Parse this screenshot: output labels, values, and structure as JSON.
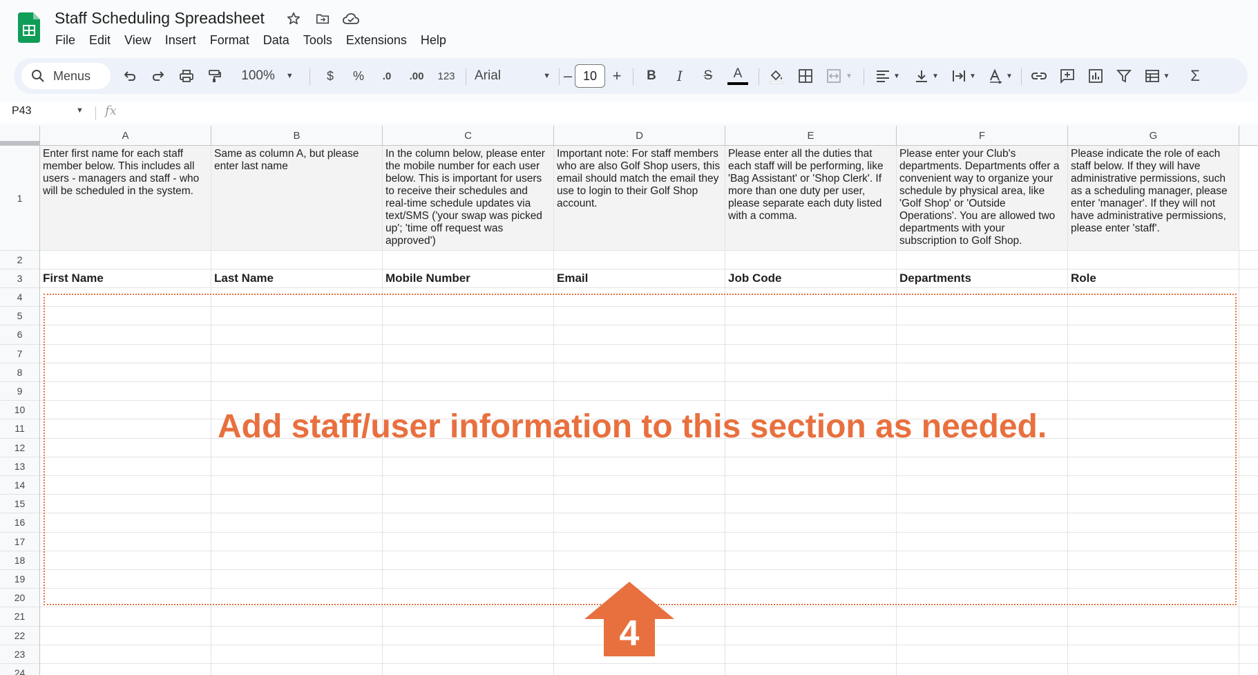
{
  "doc": {
    "title": "Staff Scheduling Spreadsheet"
  },
  "menu": [
    "File",
    "Edit",
    "View",
    "Insert",
    "Format",
    "Data",
    "Tools",
    "Extensions",
    "Help"
  ],
  "toolbar": {
    "search_label": "Menus",
    "zoom": "100%",
    "currency": "$",
    "percent": "%",
    "dec_decrease": ".0",
    "dec_increase": ".00",
    "number_format": "123",
    "font": "Arial",
    "font_size": "10",
    "bold": "B",
    "italic": "I",
    "strike": "S",
    "text_color_glyph": "A",
    "sum": "Σ"
  },
  "formula_bar": {
    "cell_ref": "P43",
    "fx": "fx"
  },
  "columns": [
    "A",
    "B",
    "C",
    "D",
    "E",
    "F",
    "G"
  ],
  "rows": [
    "1",
    "2",
    "3",
    "4",
    "5",
    "6",
    "7",
    "8",
    "9",
    "10",
    "11",
    "12",
    "13",
    "14",
    "15",
    "16",
    "17",
    "18",
    "19",
    "20",
    "21",
    "22",
    "23",
    "24"
  ],
  "descriptions": [
    "Enter first name for each staff member below. This includes all users - managers and staff - who will be scheduled in the system.",
    "Same as column A, but please enter last name",
    "In the column below, please enter the mobile number for each user below. This is important for users to receive their schedules and real-time schedule updates via text/SMS ('your swap was picked up'; 'time off request was approved')",
    "Important note: For staff members who are also Golf Shop users, this email should match the email they use to login to their Golf Shop account.",
    "Please enter all the duties that each staff will be performing, like 'Bag Assistant' or 'Shop Clerk'. If more than one duty per user, please separate each duty listed with a comma.",
    "Please enter your Club's departments. Departments offer a convenient way to organize your schedule by physical area, like 'Golf Shop' or 'Outside Operations'. You are allowed two departments with your subscription to Golf Shop.",
    "Please indicate the role of each staff below. If they will have administrative permissions, such as a scheduling manager, please enter 'manager'. If they will not have administrative permissions, please enter 'staff'."
  ],
  "headers": [
    "First Name",
    "Last Name",
    "Mobile Number",
    "Email",
    "Job Code",
    "Departments",
    "Role"
  ],
  "annotation": {
    "text": "Add staff/user information to this section as needed.",
    "step_number": "4",
    "color": "#e8703f"
  },
  "colors": {
    "accent": "#e8703f",
    "sheets_green": "#0f9d58"
  }
}
